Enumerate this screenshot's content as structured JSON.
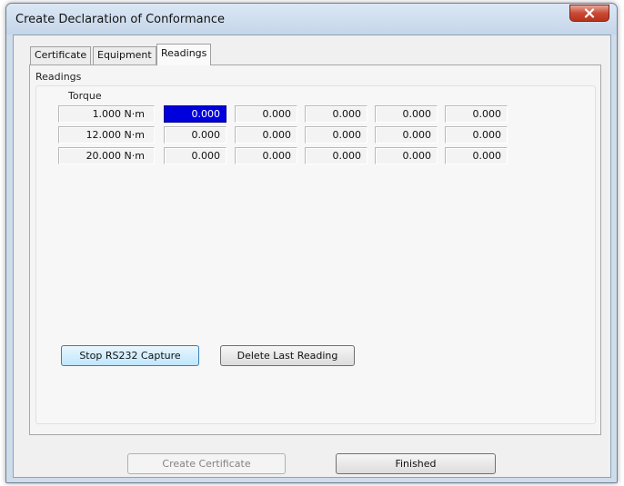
{
  "window": {
    "title": "Create Declaration of Conformance",
    "close_icon": "close-icon"
  },
  "tabs": [
    {
      "label": "Certificate",
      "active": false
    },
    {
      "label": "Equipment",
      "active": false
    },
    {
      "label": "Readings",
      "active": true
    }
  ],
  "readings": {
    "group_label": "Readings",
    "column_header": "Torque",
    "rows": [
      {
        "torque": "1.000 N·m",
        "values": [
          "0.000",
          "0.000",
          "0.000",
          "0.000",
          "0.000"
        ]
      },
      {
        "torque": "12.000 N·m",
        "values": [
          "0.000",
          "0.000",
          "0.000",
          "0.000",
          "0.000"
        ]
      },
      {
        "torque": "20.000 N·m",
        "values": [
          "0.000",
          "0.000",
          "0.000",
          "0.000",
          "0.000"
        ]
      }
    ],
    "selected_cell": "row 1, reading 1",
    "selected_color": "#0000dd"
  },
  "buttons": {
    "stop_capture": "Stop RS232 Capture",
    "delete_last": "Delete Last Reading",
    "create_certificate": "Create Certificate",
    "finished": "Finished"
  },
  "colors": {
    "close_button": "#c94a35",
    "title_bar": "#cfdcea"
  }
}
